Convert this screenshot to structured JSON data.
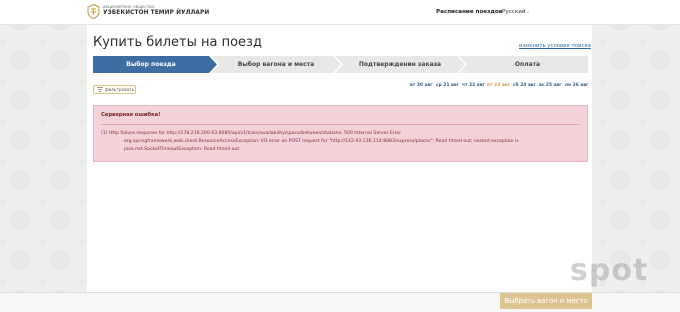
{
  "header": {
    "logo_small": "АКЦИОНЕРНОЕ ОБЩЕСТВО",
    "logo_big": "УЗБЕКИСТОН ТЕМИР ЙУЛЛАРИ",
    "nav_schedule": "Расписание поездов",
    "language": "Русский"
  },
  "main": {
    "title": "Купить билеты на поезд",
    "change_search": "изменить условия поиска",
    "steps": [
      {
        "label": "Выбор поезда",
        "active": true
      },
      {
        "label": "Выбор вагона и места",
        "active": false
      },
      {
        "label": "Подтверждение заказа",
        "active": false
      },
      {
        "label": "Оплата",
        "active": false
      }
    ],
    "filter_label": "фильтровать",
    "dates": [
      {
        "label": "вт 20 авг",
        "current": false
      },
      {
        "label": "ср 21 авг",
        "current": false
      },
      {
        "label": "чт 22 авг",
        "current": false
      },
      {
        "label": "пт 23 авг",
        "current": true
      },
      {
        "label": "сб 24 авг",
        "current": false
      },
      {
        "label": "вс 25 авг",
        "current": false
      },
      {
        "label": "пн 26 авг",
        "current": false
      }
    ],
    "error": {
      "title": "Серверная ошибка!",
      "line1": "(1) Http failure response for http://178.218.200.63:8080/api/v1/train/availability/space/between/stations: 500 Internal Server Error",
      "line2": "org.springframework.web.client.ResourceAccessException: I/O error on POST request for \"http://142.93.136.114:8083/express/places\": Read timed out; nested exception is",
      "line3": "java.net.SocketTimeoutException: Read timed out"
    }
  },
  "footer": {
    "submit_label": "Выбрать вагон и место"
  },
  "watermark": "spot",
  "colors": {
    "active_step": "#3d6da3",
    "inactive_step": "#e8e8e8",
    "error_bg": "#f3d3d8",
    "submit_bg": "#dcc493",
    "date_link": "#2f5c8a",
    "date_current": "#d99a3a"
  },
  "icons": {
    "logo": "utj-emblem-icon",
    "filter": "filter-icon",
    "lang_caret": "chevron-down-icon"
  }
}
